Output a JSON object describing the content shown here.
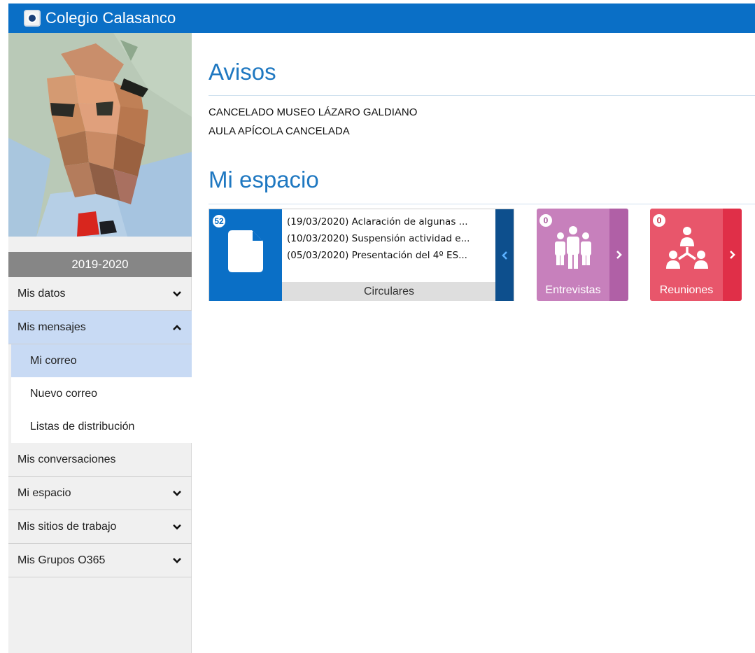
{
  "header": {
    "title": "Colegio Calasanco",
    "logo_icon": "school-crest-icon",
    "accent": "#0a6fc6"
  },
  "sidebar": {
    "year": "2019-2020",
    "items": [
      {
        "label": "Mis datos",
        "icon": "chevron-down-icon"
      },
      {
        "label": "Mis mensajes",
        "icon": "chevron-up-icon"
      },
      {
        "label": "Mis conversaciones"
      },
      {
        "label": "Mi espacio",
        "icon": "chevron-down-icon"
      },
      {
        "label": "Mis sitios de trabajo",
        "icon": "chevron-down-icon"
      },
      {
        "label": "Mis Grupos O365",
        "icon": "chevron-down-icon"
      }
    ],
    "mensajes_sub": [
      {
        "label": "Mi correo"
      },
      {
        "label": "Nuevo correo"
      },
      {
        "label": "Listas de distribución"
      }
    ]
  },
  "avisos": {
    "title": "Avisos",
    "items": [
      "CANCELADO MUSEO LÁZARO GALDIANO",
      "AULA APÍCOLA CANCELADA"
    ]
  },
  "espacio": {
    "title": "Mi espacio",
    "circulares": {
      "count": "52",
      "label": "Circulares",
      "lines": [
        "(19/03/2020) Aclaración de algunas ...",
        "(10/03/2020) Suspensión actividad e...",
        "(05/03/2020) Presentación del 4º ES..."
      ],
      "icon": "document-icon",
      "color": "#0a6fc6"
    },
    "entrevistas": {
      "count": "0",
      "label": "Entrevistas",
      "icon": "people-group-icon",
      "color": "#c780bc"
    },
    "reuniones": {
      "count": "0",
      "label": "Reuniones",
      "icon": "meeting-network-icon",
      "color": "#e8566b"
    }
  }
}
